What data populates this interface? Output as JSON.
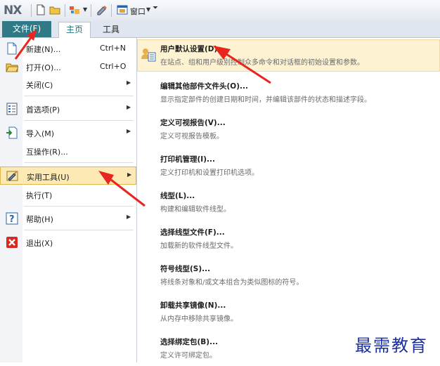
{
  "app": {
    "logo": "NX"
  },
  "quick_access": {
    "window_label": "窗口"
  },
  "ribbon": {
    "tabs": [
      {
        "label": "文件(F)"
      },
      {
        "label": "主页"
      },
      {
        "label": "工具"
      }
    ]
  },
  "file_menu": {
    "items": [
      {
        "label": "新建(N)...",
        "shortcut": "Ctrl+N"
      },
      {
        "label": "打开(O)...",
        "shortcut": "Ctrl+O"
      },
      {
        "label": "关闭(C)"
      },
      {
        "label": "首选项(P)"
      },
      {
        "label": "导入(M)"
      },
      {
        "label": "互操作(R)..."
      },
      {
        "label": "实用工具(U)"
      },
      {
        "label": "执行(T)"
      },
      {
        "label": "帮助(H)"
      },
      {
        "label": "退出(X)"
      }
    ]
  },
  "utilities_submenu": {
    "items": [
      {
        "title": "用户默认设置(D)...",
        "desc": "在站点、组和用户级别控制众多命令和对话框的初始设置和参数。"
      },
      {
        "title": "编辑其他部件文件头(O)...",
        "desc": "显示指定部件的创建日期和时间，并编辑该部件的状态和描述字段。"
      },
      {
        "title": "定义可视报告(V)...",
        "desc": "定义可视报告模板。"
      },
      {
        "title": "打印机管理(I)...",
        "desc": "定义打印机和设置打印机选项。"
      },
      {
        "title": "线型(L)...",
        "desc": "构建和编辑软件线型。"
      },
      {
        "title": "选择线型文件(F)...",
        "desc": "加载新的软件线型文件。"
      },
      {
        "title": "符号线型(S)...",
        "desc": "将线条对象和/或文本组合为类似图标的符号。"
      },
      {
        "title": "卸载共享镜像(N)...",
        "desc": "从内存中移除共享镜像。"
      },
      {
        "title": "选择绑定包(B)...",
        "desc": "定义许可绑定包。"
      }
    ]
  },
  "watermark": "最需教育",
  "colors": {
    "file_tab": "#2f7a86",
    "highlight": "#fce9b4",
    "arrow": "#e8251f",
    "watermark": "#1a2fa8"
  }
}
